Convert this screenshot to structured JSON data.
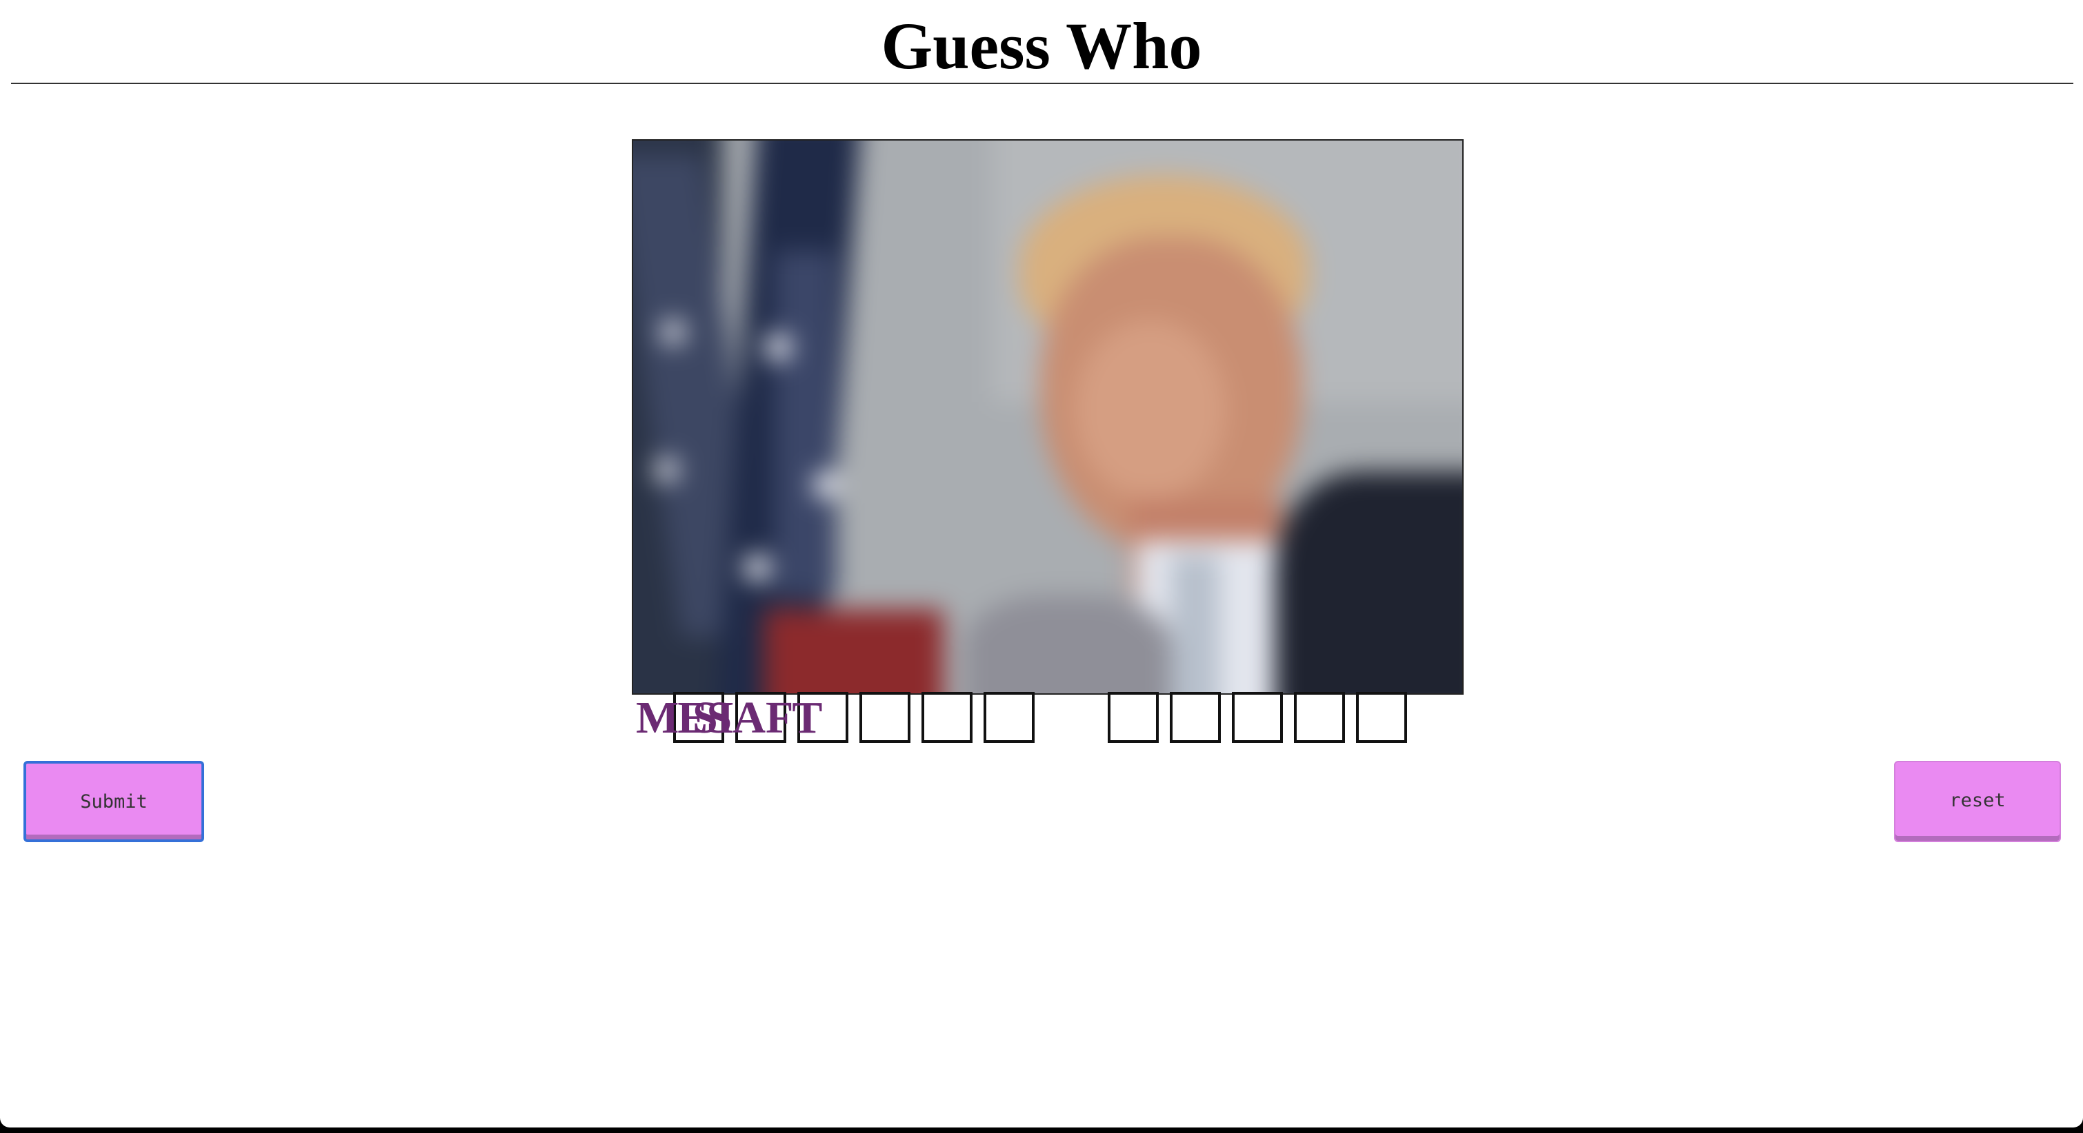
{
  "header": {
    "title": "Guess Who"
  },
  "image": {
    "description_icon": "blurred-portrait-photo"
  },
  "guess": {
    "typed_letters_overlapping": [
      "MES",
      "SIA",
      "FT"
    ],
    "first_word_box_count": 6,
    "second_word_box_count": 5
  },
  "buttons": {
    "submit_label": "Submit",
    "reset_label": "reset"
  },
  "colors": {
    "button_bg": "#ea8af2",
    "guess_text": "#6b2a73",
    "focus_border": "#3470d8"
  }
}
